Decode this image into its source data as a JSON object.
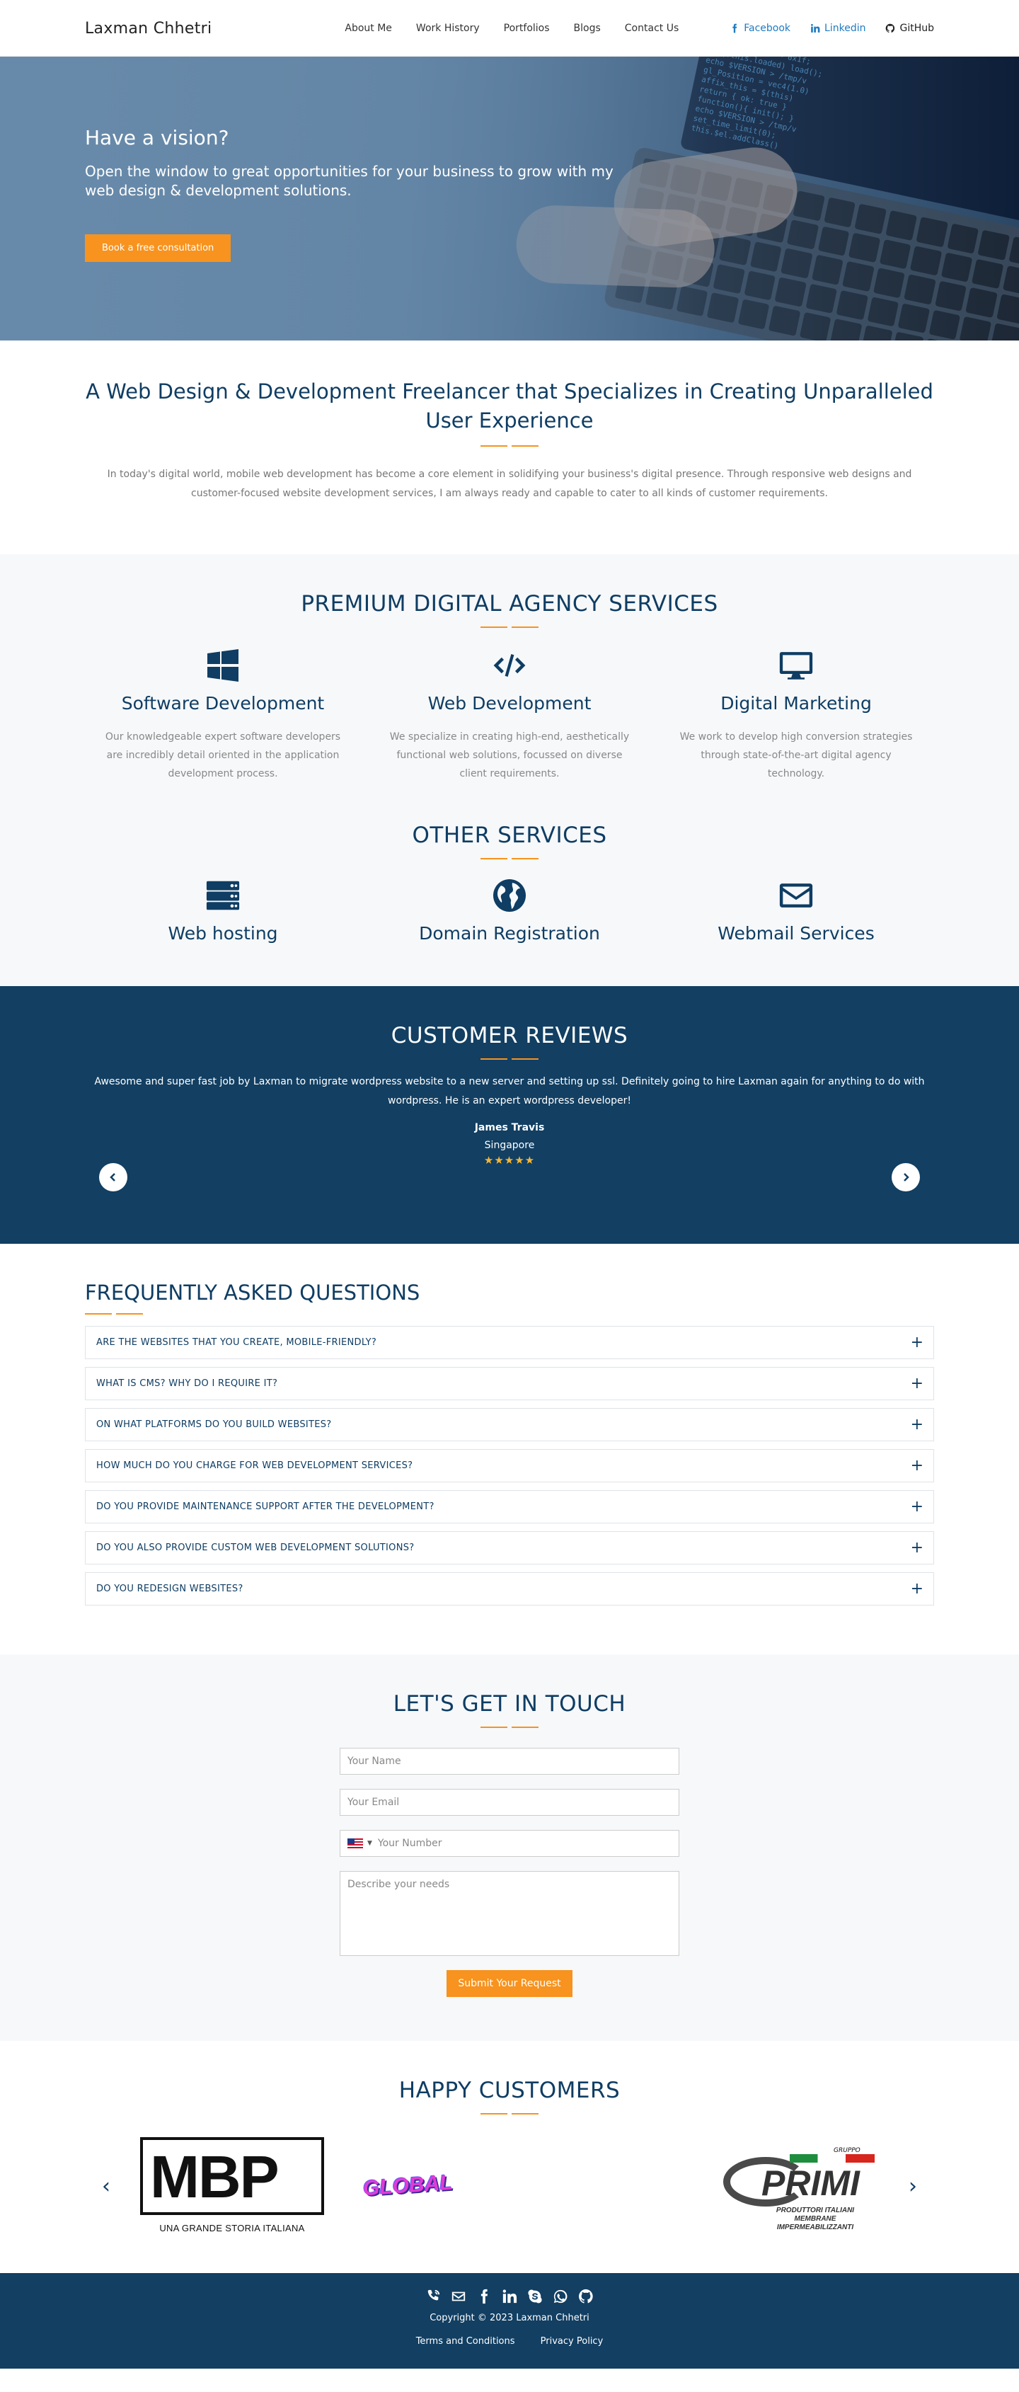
{
  "nav": {
    "brand": "Laxman Chhetri",
    "links": [
      "About Me",
      "Work History",
      "Portfolios",
      "Blogs",
      "Contact Us"
    ],
    "social": [
      "Facebook",
      "Linkedin",
      "GitHub"
    ]
  },
  "hero": {
    "title": "Have a vision?",
    "subtitle": "Open the window to great opportunities for your business to grow with my web design & development solutions.",
    "cta": "Book a free consultation"
  },
  "intro": {
    "heading": "A Web Design & Development Freelancer that Specializes in Creating Unparalleled User Experience",
    "text": "In today's digital world, mobile web development has become a core element in solidifying your business's digital presence. Through responsive web designs and customer-focused website development services, I am always ready and capable to cater to all kinds of customer requirements."
  },
  "services": {
    "title": "PREMIUM DIGITAL AGENCY SERVICES",
    "items": [
      {
        "icon": "windows-icon",
        "name": "Software Development",
        "text": "Our knowledgeable expert software developers are incredibly detail oriented in the application development process."
      },
      {
        "icon": "code-icon",
        "name": "Web Development",
        "text": "We specialize in creating high-end, aesthetically functional web solutions, focussed on diverse client requirements."
      },
      {
        "icon": "monitor-icon",
        "name": "Digital Marketing",
        "text": "We work to develop high conversion strategies through state-of-the-art digital agency technology."
      }
    ],
    "other_title": "OTHER SERVICES",
    "other": [
      {
        "icon": "server-icon",
        "name": "Web hosting"
      },
      {
        "icon": "globe-icon",
        "name": "Domain Registration"
      },
      {
        "icon": "envelope-icon",
        "name": "Webmail Services"
      }
    ]
  },
  "reviews": {
    "title": "CUSTOMER REVIEWS",
    "quote": "Awesome and super fast job by Laxman to migrate wordpress website to a new server and setting up ssl. Definitely going to hire Laxman again for anything to do with wordpress. He is an expert wordpress developer!",
    "name": "James Travis",
    "location": "Singapore",
    "rating": 5,
    "stars": "★★★★★"
  },
  "faq": {
    "title": "FREQUENTLY ASKED QUESTIONS",
    "items": [
      "ARE THE WEBSITES THAT YOU CREATE, MOBILE-FRIENDLY?",
      "WHAT IS CMS? WHY DO I REQUIRE IT?",
      "ON WHAT PLATFORMS DO YOU BUILD WEBSITES?",
      "HOW MUCH DO YOU CHARGE FOR WEB DEVELOPMENT SERVICES?",
      "DO YOU PROVIDE MAINTENANCE SUPPORT AFTER THE DEVELOPMENT?",
      "DO YOU ALSO PROVIDE CUSTOM WEB DEVELOPMENT SOLUTIONS?",
      "DO YOU REDESIGN WEBSITES?"
    ]
  },
  "contact": {
    "title": "LET'S GET IN TOUCH",
    "name_placeholder": "Your Name",
    "email_placeholder": "Your Email",
    "phone_placeholder": "Your Number",
    "needs_placeholder": "Describe your needs",
    "submit": "Submit Your Request"
  },
  "customers": {
    "title": "HAPPY CUSTOMERS",
    "logos": [
      {
        "text": "MBP",
        "sub": "UNA GRANDE STORIA ITALIANA"
      },
      {
        "text": "GLOBAL"
      },
      {
        "text": "PRIMI",
        "tag": "GRUPPO",
        "sub": "PRODUTTORI ITALIANI MEMBRANE IMPERMEABILIZZANTI"
      }
    ]
  },
  "footer": {
    "copyright": "Copyright © 2023 Laxman Chhetri",
    "links": [
      "Terms and Conditions",
      "Privacy Policy"
    ]
  },
  "colors": {
    "primary": "#0f3d63",
    "accent": "#f7931e",
    "dark_band": "#123f62",
    "link_blue": "#1f7bc1"
  }
}
